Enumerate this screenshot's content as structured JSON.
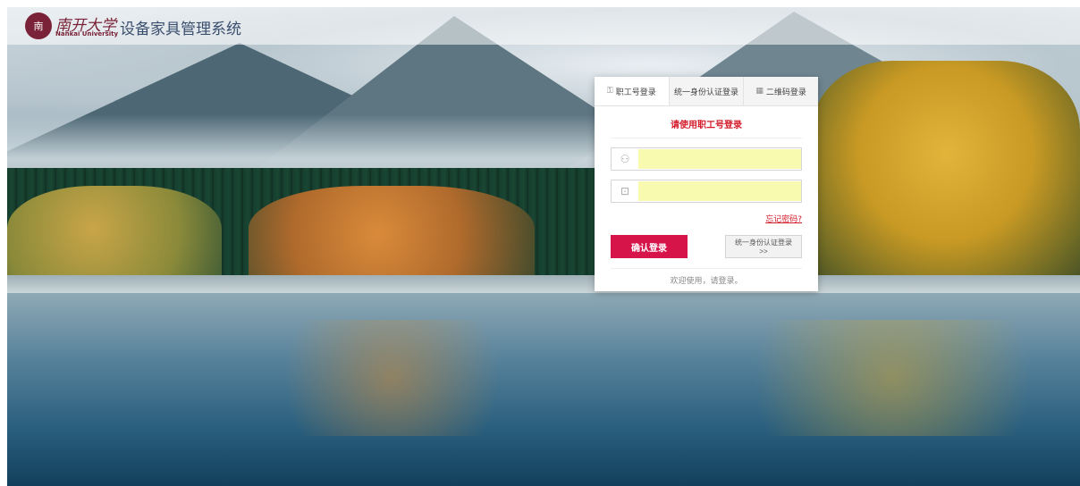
{
  "header": {
    "logo_glyph": "南",
    "logo_cn": "南开大学",
    "logo_en": "Nankai University",
    "system_title": "设备家具管理系统"
  },
  "login": {
    "tabs": [
      {
        "icon": "key-icon",
        "icon_glyph": "⚿",
        "label": "职工号登录",
        "active": true
      },
      {
        "icon": "",
        "icon_glyph": "",
        "label": "统一身份认证登录",
        "active": false
      },
      {
        "icon": "qrcode-icon",
        "icon_glyph": "▦",
        "label": "二维码登录",
        "active": false
      }
    ],
    "subtitle": "请使用职工号登录",
    "username": {
      "icon_glyph": "⚇",
      "value": ""
    },
    "password": {
      "icon_glyph": "⊡",
      "value": ""
    },
    "forgot_label": "忘记密码?",
    "submit_label": "确认登录",
    "alt_label": "统一身份认证登录>>",
    "welcome": "欢迎使用，请登录。"
  },
  "colors": {
    "accent": "#d6144a",
    "brand": "#7a2237",
    "warning_text": "#d41c2a"
  }
}
